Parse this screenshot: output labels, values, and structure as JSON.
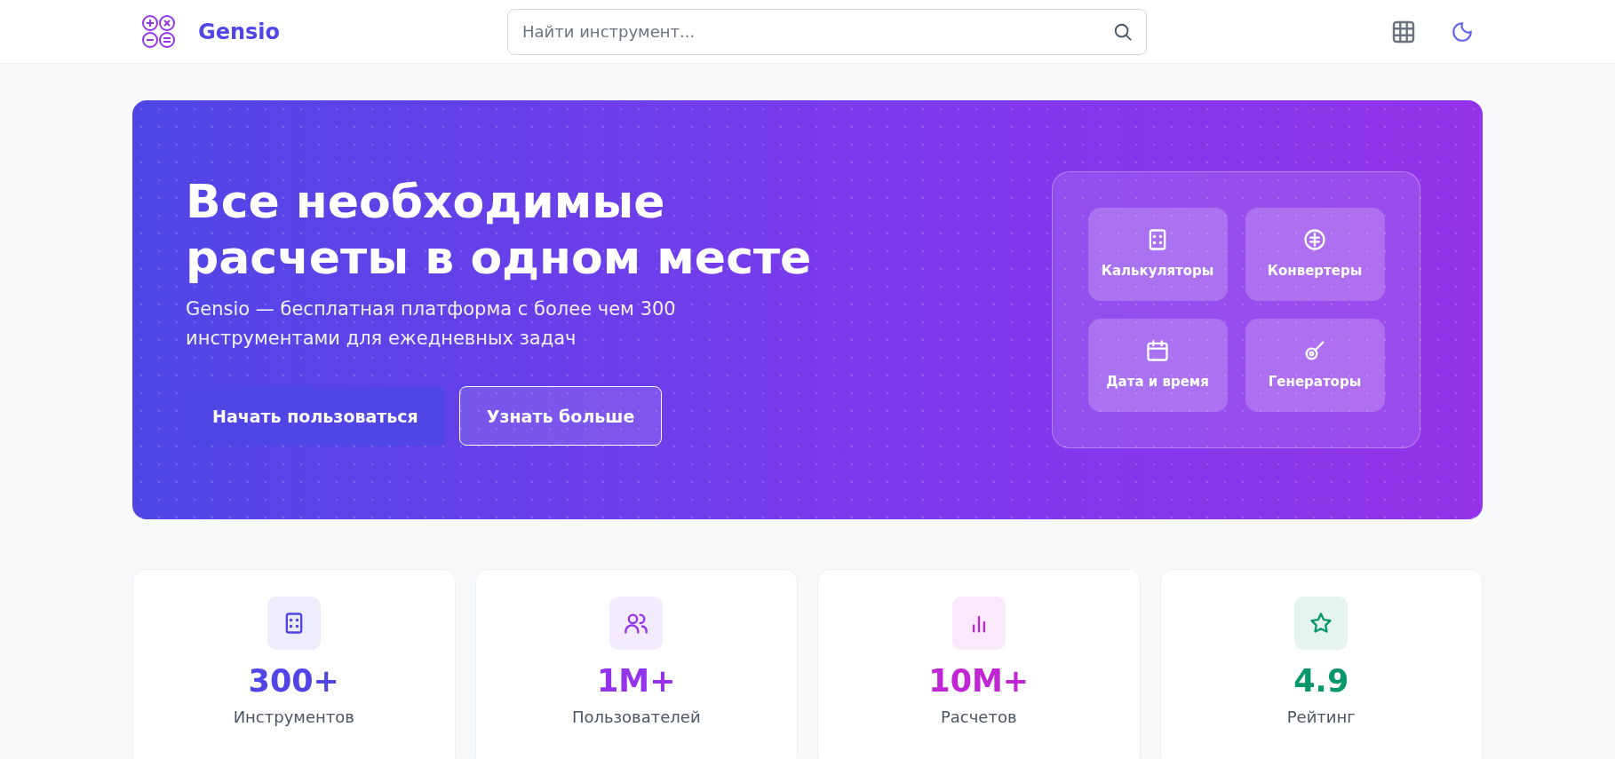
{
  "header": {
    "logo_text": "Gensio",
    "search": {
      "placeholder": "Найти инструмент..."
    }
  },
  "hero": {
    "title": "Все необходимые расчеты в одном месте",
    "subtitle": "Gensio — бесплатная платформа с более чем 300 инструментами для ежедневных задач",
    "buttons": [
      {
        "label": "Начать пользоваться",
        "kind": "primary"
      },
      {
        "label": "Узнать больше",
        "kind": "outline"
      }
    ],
    "categories": [
      {
        "label": "Калькуляторы",
        "kind": "calculator"
      },
      {
        "label": "Конвертеры",
        "kind": "converter"
      },
      {
        "label": "Дата и время",
        "kind": "calendar"
      },
      {
        "label": "Генераторы",
        "kind": "generator"
      }
    ]
  },
  "stats": [
    {
      "value": "300+",
      "label": "Инструментов",
      "kind": "calculator",
      "color": "#4f46e5"
    },
    {
      "value": "1M+",
      "label": "Пользователей",
      "kind": "users",
      "color": "#9333ea"
    },
    {
      "value": "10M+",
      "label": "Расчетов",
      "kind": "chart",
      "color": "#c026d3"
    },
    {
      "value": "4.9",
      "label": "Рейтинг",
      "kind": "star",
      "color": "#059669"
    }
  ]
}
